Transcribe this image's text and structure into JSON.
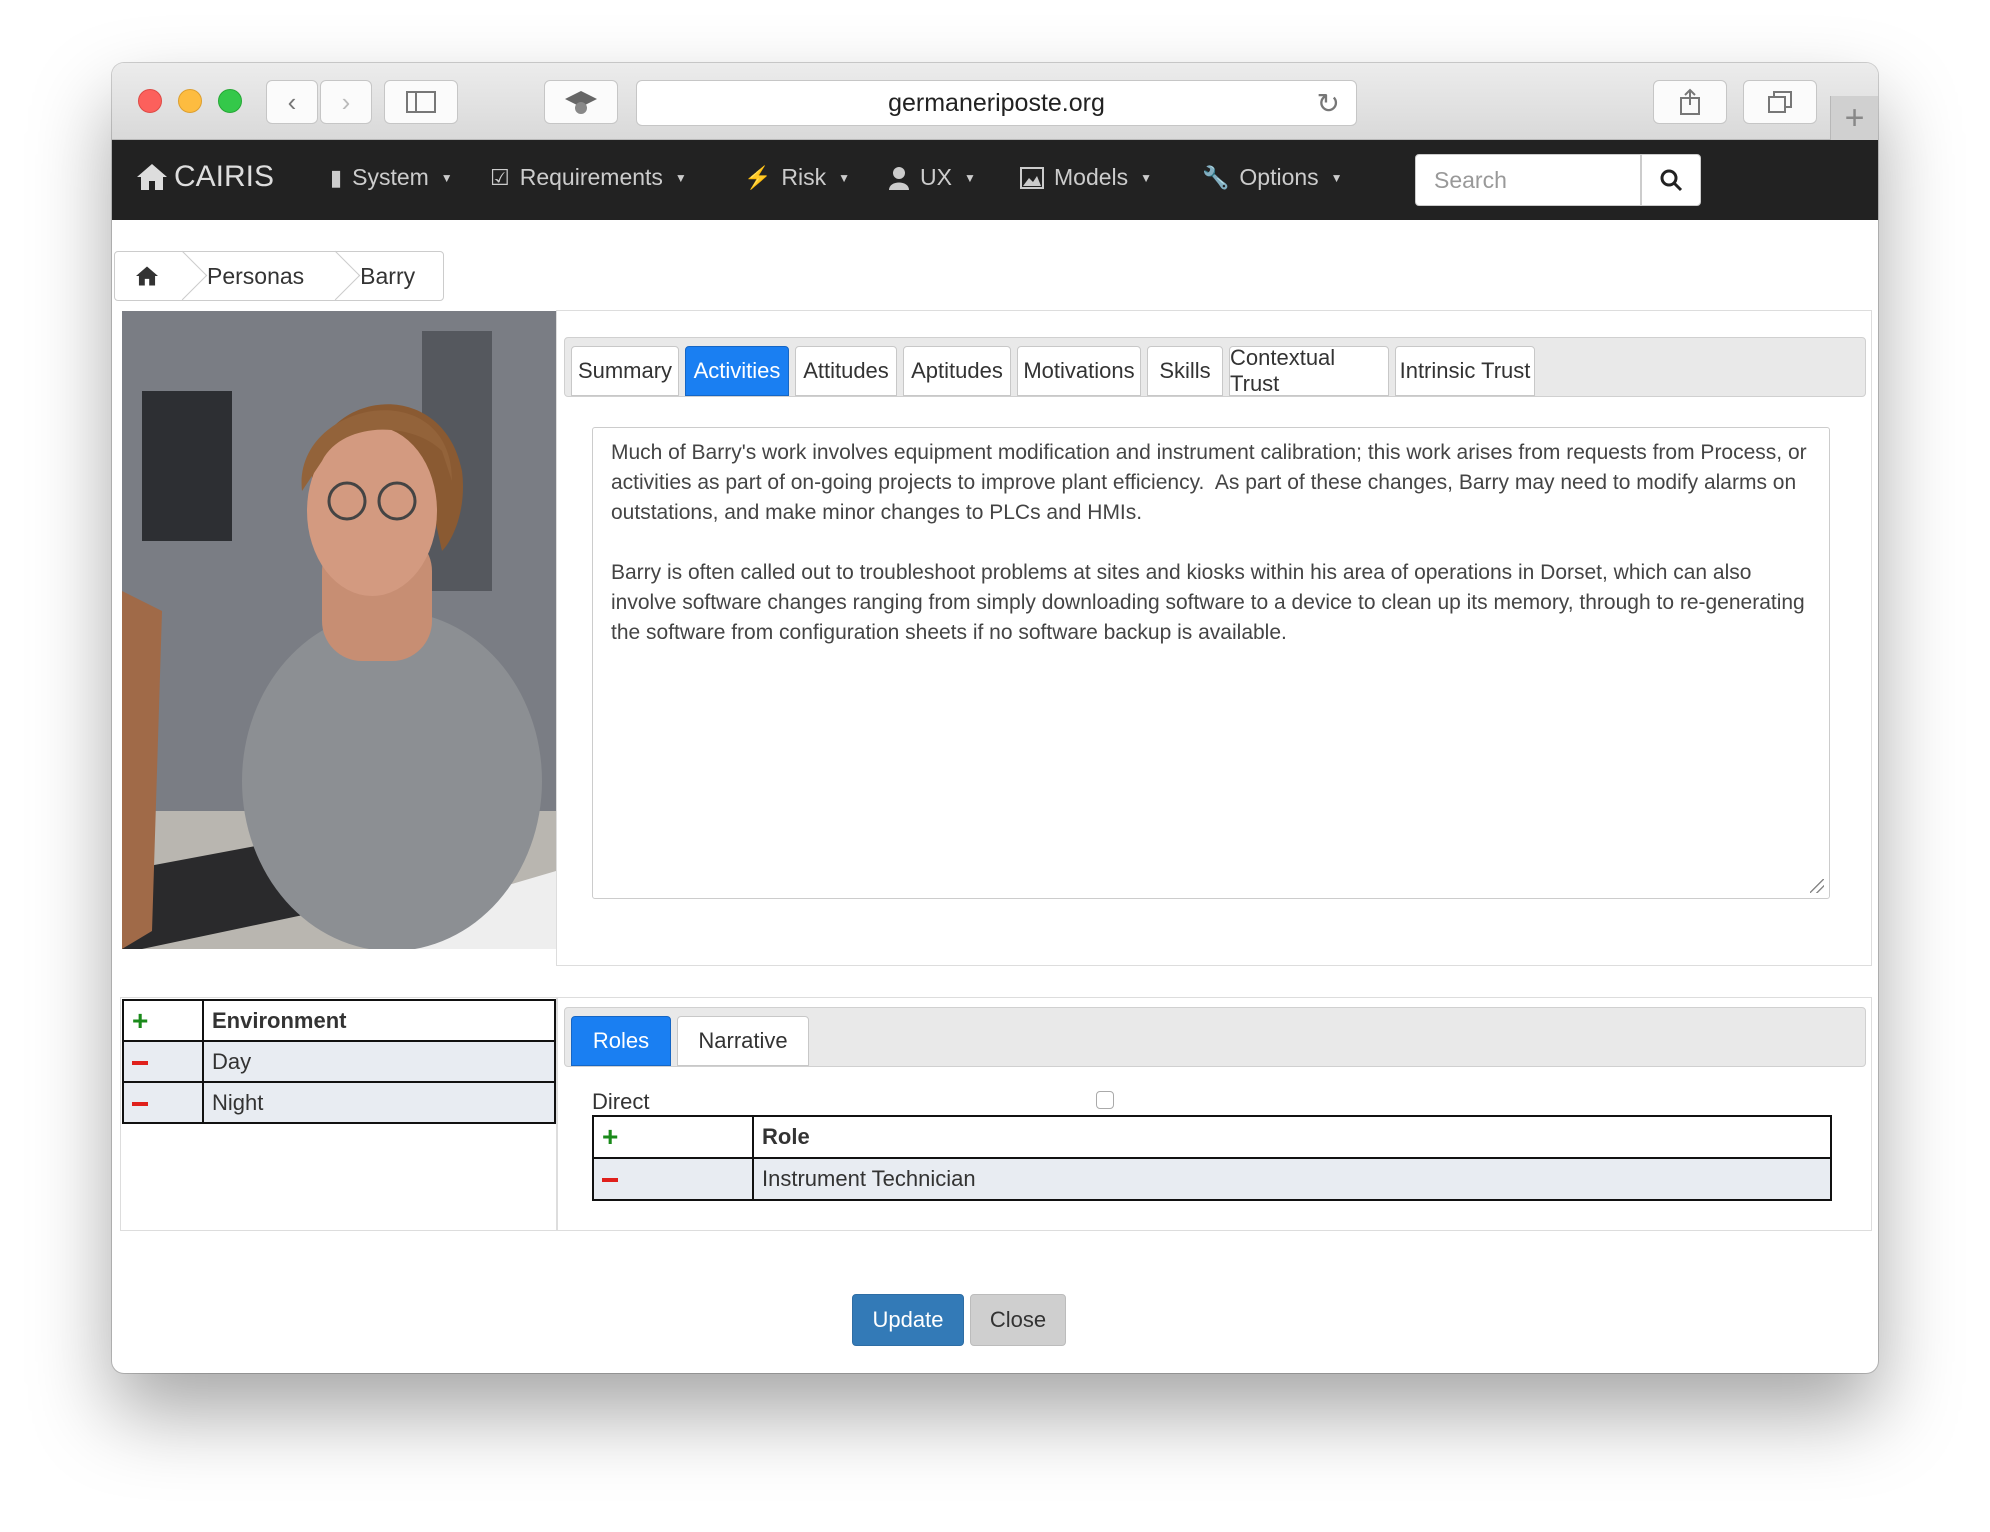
{
  "browser": {
    "url": "germaneriposte.org"
  },
  "navbar": {
    "brand": "CAIRIS",
    "items": [
      {
        "label": "System",
        "icon": "book-icon"
      },
      {
        "label": "Requirements",
        "icon": "checkbox-icon"
      },
      {
        "label": "Risk",
        "icon": "bolt-icon"
      },
      {
        "label": "UX",
        "icon": "user-icon"
      },
      {
        "label": "Models",
        "icon": "picture-icon"
      },
      {
        "label": "Options",
        "icon": "wrench-icon"
      }
    ],
    "search_placeholder": "Search"
  },
  "breadcrumb": {
    "items": [
      "Personas",
      "Barry"
    ]
  },
  "persona_tabs": {
    "tabs": [
      "Summary",
      "Activities",
      "Attitudes",
      "Aptitudes",
      "Motivations",
      "Skills",
      "Contextual Trust",
      "Intrinsic Trust"
    ],
    "active": "Activities",
    "activities_text": "Much of Barry's work involves equipment modification and instrument calibration; this work arises from requests from Process, or activities as part of on-going projects to improve plant efficiency.  As part of these changes, Barry may need to modify alarms on outstations, and make minor changes to PLCs and HMIs.\n\nBarry is often called out to troubleshoot problems at sites and kiosks within his area of operations in Dorset, which can also involve software changes ranging from simply downloading software to a device to clean up its memory, through to re-generating the software from configuration sheets if no software backup is available."
  },
  "environments": {
    "header": "Environment",
    "rows": [
      "Day",
      "Night"
    ]
  },
  "env_tabs": {
    "tabs": [
      "Roles",
      "Narrative"
    ],
    "active": "Roles"
  },
  "roles": {
    "direct_label": "Direct",
    "header": "Role",
    "rows": [
      "Instrument Technician"
    ]
  },
  "buttons": {
    "update": "Update",
    "close": "Close"
  }
}
